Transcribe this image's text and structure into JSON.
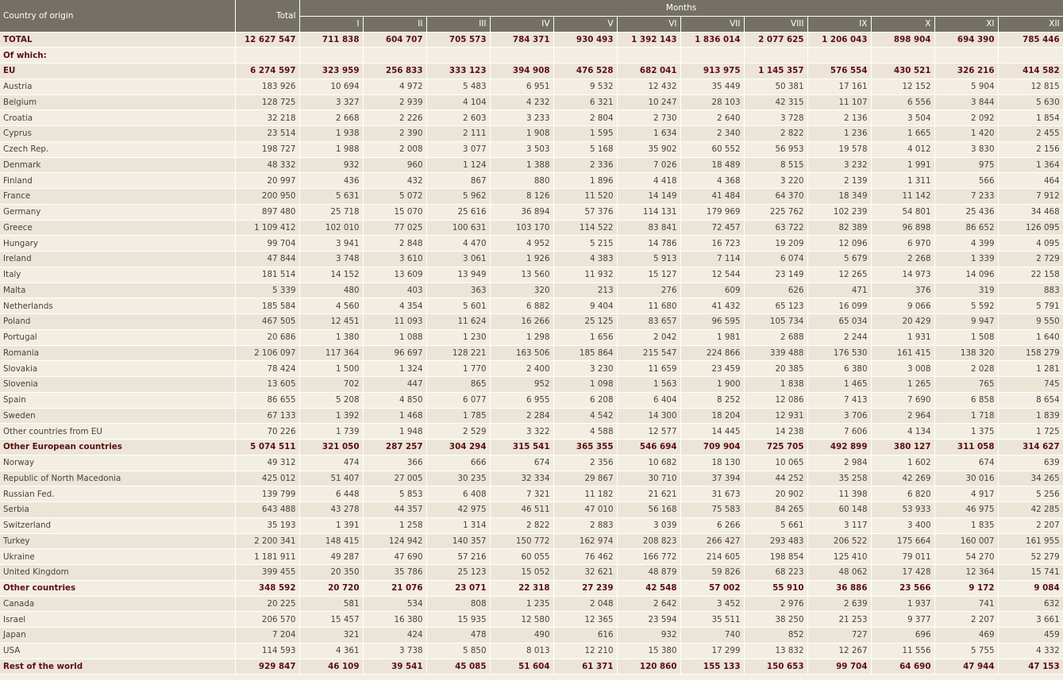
{
  "header": {
    "country_label": "Country of origin",
    "total_label": "Total",
    "months_label": "Months",
    "months": [
      "I",
      "II",
      "III",
      "IV",
      "V",
      "VI",
      "VII",
      "VIII",
      "IX",
      "X",
      "XI",
      "XII"
    ]
  },
  "rows": [
    {
      "name": "TOTAL",
      "bold": true,
      "total": "12 627 547",
      "m": [
        "711 838",
        "604 707",
        "705 573",
        "784 371",
        "930 493",
        "1 392 143",
        "1 836 014",
        "2 077 625",
        "1 206 043",
        "898 904",
        "694 390",
        "785 446"
      ]
    },
    {
      "name": "Of which:",
      "bold": true,
      "total": "",
      "m": [
        "",
        "",
        "",
        "",
        "",
        "",
        "",
        "",
        "",
        "",
        "",
        ""
      ]
    },
    {
      "name": "EU",
      "bold": true,
      "total": "6 274 597",
      "m": [
        "323 959",
        "256 833",
        "333 123",
        "394 908",
        "476 528",
        "682 041",
        "913 975",
        "1 145 357",
        "576 554",
        "430 521",
        "326 216",
        "414 582"
      ]
    },
    {
      "name": "Austria",
      "bold": false,
      "total": "183 926",
      "m": [
        "10 694",
        "4 972",
        "5 483",
        "6 951",
        "9 532",
        "12 432",
        "35 449",
        "50 381",
        "17 161",
        "12 152",
        "5 904",
        "12 815"
      ]
    },
    {
      "name": "Belgium",
      "bold": false,
      "total": "128 725",
      "m": [
        "3 327",
        "2 939",
        "4 104",
        "4 232",
        "6 321",
        "10 247",
        "28 103",
        "42 315",
        "11 107",
        "6 556",
        "3 844",
        "5 630"
      ]
    },
    {
      "name": "Croatia",
      "bold": false,
      "total": "32 218",
      "m": [
        "2 668",
        "2 226",
        "2 603",
        "3 233",
        "2 804",
        "2 730",
        "2 640",
        "3 728",
        "2 136",
        "3 504",
        "2 092",
        "1 854"
      ]
    },
    {
      "name": "Cyprus",
      "bold": false,
      "total": "23 514",
      "m": [
        "1 938",
        "2 390",
        "2 111",
        "1 908",
        "1 595",
        "1 634",
        "2 340",
        "2 822",
        "1 236",
        "1 665",
        "1 420",
        "2 455"
      ]
    },
    {
      "name": "Czech Rep.",
      "bold": false,
      "total": "198 727",
      "m": [
        "1 988",
        "2 008",
        "3 077",
        "3 503",
        "5 168",
        "35 902",
        "60 552",
        "56 953",
        "19 578",
        "4 012",
        "3 830",
        "2 156"
      ]
    },
    {
      "name": "Denmark",
      "bold": false,
      "total": "48 332",
      "m": [
        "932",
        "960",
        "1 124",
        "1 388",
        "2 336",
        "7 026",
        "18 489",
        "8 515",
        "3 232",
        "1 991",
        "975",
        "1 364"
      ]
    },
    {
      "name": "Finland",
      "bold": false,
      "total": "20 997",
      "m": [
        "436",
        "432",
        "867",
        "880",
        "1 896",
        "4 418",
        "4 368",
        "3 220",
        "2 139",
        "1 311",
        "566",
        "464"
      ]
    },
    {
      "name": "France",
      "bold": false,
      "total": "200 950",
      "m": [
        "5 631",
        "5 072",
        "5 962",
        "8 126",
        "11 520",
        "14 149",
        "41 484",
        "64 370",
        "18 349",
        "11 142",
        "7 233",
        "7 912"
      ]
    },
    {
      "name": "Germany",
      "bold": false,
      "total": "897 480",
      "m": [
        "25 718",
        "15 070",
        "25 616",
        "36 894",
        "57 376",
        "114 131",
        "179 969",
        "225 762",
        "102 239",
        "54 801",
        "25 436",
        "34 468"
      ]
    },
    {
      "name": "Greece",
      "bold": false,
      "total": "1 109 412",
      "m": [
        "102 010",
        "77 025",
        "100 631",
        "103 170",
        "114 522",
        "83 841",
        "72 457",
        "63 722",
        "82 389",
        "96 898",
        "86 652",
        "126 095"
      ]
    },
    {
      "name": "Hungary",
      "bold": false,
      "total": "99 704",
      "m": [
        "3 941",
        "2 848",
        "4 470",
        "4 952",
        "5 215",
        "14 786",
        "16 723",
        "19 209",
        "12 096",
        "6 970",
        "4 399",
        "4 095"
      ]
    },
    {
      "name": "Ireland",
      "bold": false,
      "total": "47 844",
      "m": [
        "3 748",
        "3 610",
        "3 061",
        "1 926",
        "4 383",
        "5 913",
        "7 114",
        "6 074",
        "5 679",
        "2 268",
        "1 339",
        "2 729"
      ]
    },
    {
      "name": "Italy",
      "bold": false,
      "total": "181 514",
      "m": [
        "14 152",
        "13 609",
        "13 949",
        "13 560",
        "11 932",
        "15 127",
        "12 544",
        "23 149",
        "12 265",
        "14 973",
        "14 096",
        "22 158"
      ]
    },
    {
      "name": "Malta",
      "bold": false,
      "total": "5 339",
      "m": [
        "480",
        "403",
        "363",
        "320",
        "213",
        "276",
        "609",
        "626",
        "471",
        "376",
        "319",
        "883"
      ]
    },
    {
      "name": "Netherlands",
      "bold": false,
      "total": "185 584",
      "m": [
        "4 560",
        "4 354",
        "5 601",
        "6 882",
        "9 404",
        "11 680",
        "41 432",
        "65 123",
        "16 099",
        "9 066",
        "5 592",
        "5 791"
      ]
    },
    {
      "name": "Poland",
      "bold": false,
      "total": "467 505",
      "m": [
        "12 451",
        "11 093",
        "11 624",
        "16 266",
        "25 125",
        "83 657",
        "96 595",
        "105 734",
        "65 034",
        "20 429",
        "9 947",
        "9 550"
      ]
    },
    {
      "name": "Portugal",
      "bold": false,
      "total": "20 686",
      "m": [
        "1 380",
        "1 088",
        "1 230",
        "1 298",
        "1 656",
        "2 042",
        "1 981",
        "2 688",
        "2 244",
        "1 931",
        "1 508",
        "1 640"
      ]
    },
    {
      "name": "Romania",
      "bold": false,
      "total": "2 106 097",
      "m": [
        "117 364",
        "96 697",
        "128 221",
        "163 506",
        "185 864",
        "215 547",
        "224 866",
        "339 488",
        "176 530",
        "161 415",
        "138 320",
        "158 279"
      ]
    },
    {
      "name": "Slovakia",
      "bold": false,
      "total": "78 424",
      "m": [
        "1 500",
        "1 324",
        "1 770",
        "2 400",
        "3 230",
        "11 659",
        "23 459",
        "20 385",
        "6 380",
        "3 008",
        "2 028",
        "1 281"
      ]
    },
    {
      "name": "Slovenia",
      "bold": false,
      "total": "13 605",
      "m": [
        "702",
        "447",
        "865",
        "952",
        "1 098",
        "1 563",
        "1 900",
        "1 838",
        "1 465",
        "1 265",
        "765",
        "745"
      ]
    },
    {
      "name": "Spain",
      "bold": false,
      "total": "86 655",
      "m": [
        "5 208",
        "4 850",
        "6 077",
        "6 955",
        "6 208",
        "6 404",
        "8 252",
        "12 086",
        "7 413",
        "7 690",
        "6 858",
        "8 654"
      ]
    },
    {
      "name": "Sweden",
      "bold": false,
      "total": "67 133",
      "m": [
        "1 392",
        "1 468",
        "1 785",
        "2 284",
        "4 542",
        "14 300",
        "18 204",
        "12 931",
        "3 706",
        "2 964",
        "1 718",
        "1 839"
      ]
    },
    {
      "name": "Other countries from EU",
      "bold": false,
      "total": "70 226",
      "m": [
        "1 739",
        "1 948",
        "2 529",
        "3 322",
        "4 588",
        "12 577",
        "14 445",
        "14 238",
        "7 606",
        "4 134",
        "1 375",
        "1 725"
      ]
    },
    {
      "name": "Other European countries",
      "bold": true,
      "total": "5 074 511",
      "m": [
        "321 050",
        "287 257",
        "304 294",
        "315 541",
        "365 355",
        "546 694",
        "709 904",
        "725 705",
        "492 899",
        "380 127",
        "311 058",
        "314 627"
      ]
    },
    {
      "name": "Norway",
      "bold": false,
      "total": "49 312",
      "m": [
        "474",
        "366",
        "666",
        "674",
        "2 356",
        "10 682",
        "18 130",
        "10 065",
        "2 984",
        "1 602",
        "674",
        "639"
      ]
    },
    {
      "name": "Republic of North Macedonia",
      "bold": false,
      "total": "425 012",
      "m": [
        "51 407",
        "27 005",
        "30 235",
        "32 334",
        "29 867",
        "30 710",
        "37 394",
        "44 252",
        "35 258",
        "42 269",
        "30 016",
        "34 265"
      ]
    },
    {
      "name": "Russian Fed.",
      "bold": false,
      "total": "139 799",
      "m": [
        "6 448",
        "5 853",
        "6 408",
        "7 321",
        "11 182",
        "21 621",
        "31 673",
        "20 902",
        "11 398",
        "6 820",
        "4 917",
        "5 256"
      ]
    },
    {
      "name": "Serbia",
      "bold": false,
      "total": "643 488",
      "m": [
        "43 278",
        "44 357",
        "42 975",
        "46 511",
        "47 010",
        "56 168",
        "75 583",
        "84 265",
        "60 148",
        "53 933",
        "46 975",
        "42 285"
      ]
    },
    {
      "name": "Switzerland",
      "bold": false,
      "total": "35 193",
      "m": [
        "1 391",
        "1 258",
        "1 314",
        "2 822",
        "2 883",
        "3 039",
        "6 266",
        "5 661",
        "3 117",
        "3 400",
        "1 835",
        "2 207"
      ]
    },
    {
      "name": "Turkey",
      "bold": false,
      "total": "2 200 341",
      "m": [
        "148 415",
        "124 942",
        "140 357",
        "150 772",
        "162 974",
        "208 823",
        "266 427",
        "293 483",
        "206 522",
        "175 664",
        "160 007",
        "161 955"
      ]
    },
    {
      "name": "Ukraine",
      "bold": false,
      "total": "1 181 911",
      "m": [
        "49 287",
        "47 690",
        "57 216",
        "60 055",
        "76 462",
        "166 772",
        "214 605",
        "198 854",
        "125 410",
        "79 011",
        "54 270",
        "52 279"
      ]
    },
    {
      "name": "United Kingdom",
      "bold": false,
      "total": "399 455",
      "m": [
        "20 350",
        "35 786",
        "25 123",
        "15 052",
        "32 621",
        "48 879",
        "59 826",
        "68 223",
        "48 062",
        "17 428",
        "12 364",
        "15 741"
      ]
    },
    {
      "name": "Other countries",
      "bold": true,
      "total": "348 592",
      "m": [
        "20 720",
        "21 076",
        "23 071",
        "22 318",
        "27 239",
        "42 548",
        "57 002",
        "55 910",
        "36 886",
        "23 566",
        "9 172",
        "9 084"
      ]
    },
    {
      "name": "Canada",
      "bold": false,
      "total": "20 225",
      "m": [
        "581",
        "534",
        "808",
        "1 235",
        "2 048",
        "2 642",
        "3 452",
        "2 976",
        "2 639",
        "1 937",
        "741",
        "632"
      ]
    },
    {
      "name": "Israel",
      "bold": false,
      "total": "206 570",
      "m": [
        "15 457",
        "16 380",
        "15 935",
        "12 580",
        "12 365",
        "23 594",
        "35 511",
        "38 250",
        "21 253",
        "9 377",
        "2 207",
        "3 661"
      ]
    },
    {
      "name": "Japan",
      "bold": false,
      "total": "7 204",
      "m": [
        "321",
        "424",
        "478",
        "490",
        "616",
        "932",
        "740",
        "852",
        "727",
        "696",
        "469",
        "459"
      ]
    },
    {
      "name": "USA",
      "bold": false,
      "total": "114 593",
      "m": [
        "4 361",
        "3 738",
        "5 850",
        "8 013",
        "12 210",
        "15 380",
        "17 299",
        "13 832",
        "12 267",
        "11 556",
        "5 755",
        "4 332"
      ]
    },
    {
      "name": "Rest of the world",
      "bold": true,
      "total": "929 847",
      "m": [
        "46 109",
        "39 541",
        "45 085",
        "51 604",
        "61 371",
        "120 860",
        "155 133",
        "150 653",
        "99 704",
        "64 690",
        "47 944",
        "47 153"
      ]
    }
  ]
}
